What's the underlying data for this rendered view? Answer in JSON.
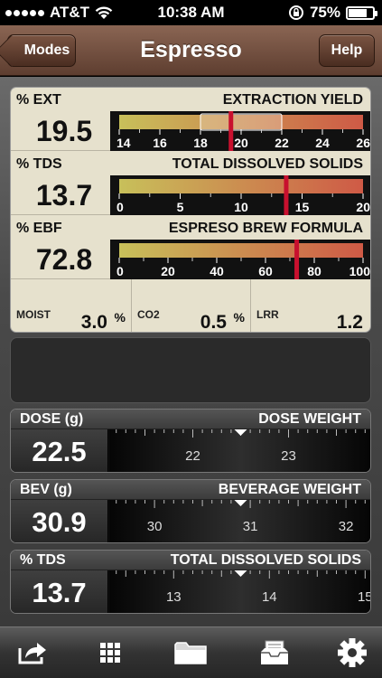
{
  "status_bar": {
    "carrier": "AT&T",
    "time": "10:38 AM",
    "battery": "75%",
    "battery_level": 0.75
  },
  "navbar": {
    "title": "Espresso",
    "left_button": "Modes",
    "right_button": "Help"
  },
  "results": [
    {
      "unit": "% EXT",
      "name": "EXTRACTION YIELD",
      "value": "19.5",
      "ticks": [
        "14",
        "16",
        "18",
        "20",
        "22",
        "24",
        "26"
      ],
      "min": 14,
      "max": 26,
      "marker": 19.5,
      "target_range": [
        18,
        22
      ]
    },
    {
      "unit": "% TDS",
      "name": "TOTAL DISSOLVED SOLIDS",
      "value": "13.7",
      "ticks": [
        "0",
        "5",
        "10",
        "15",
        "20"
      ],
      "min": 0,
      "max": 20,
      "marker": 13.7
    },
    {
      "unit": "% EBF",
      "name": "ESPRESO BREW FORMULA",
      "value": "72.8",
      "ticks": [
        "0",
        "20",
        "40",
        "60",
        "80",
        "100"
      ],
      "min": 0,
      "max": 100,
      "marker": 72.8
    }
  ],
  "secondary": [
    {
      "label": "MOIST",
      "value": "3.0",
      "unit": "%"
    },
    {
      "label": "CO2",
      "value": "0.5",
      "unit": "%"
    },
    {
      "label": "LRR",
      "value": "1.2",
      "unit": ""
    }
  ],
  "inputs": [
    {
      "unit": "DOSE (g)",
      "name": "DOSE WEIGHT",
      "value": "22.5",
      "ticks": [
        "22",
        "23"
      ]
    },
    {
      "unit": "BEV (g)",
      "name": "BEVERAGE WEIGHT",
      "value": "30.9",
      "ticks": [
        "30",
        "31",
        "32"
      ]
    },
    {
      "unit": "% TDS",
      "name": "TOTAL DISSOLVED SOLIDS",
      "value": "13.7",
      "ticks": [
        "13",
        "14",
        "15"
      ]
    }
  ],
  "toolbar": [
    {
      "icon": "share-icon"
    },
    {
      "icon": "grid-icon"
    },
    {
      "icon": "folder-icon"
    },
    {
      "icon": "inbox-icon"
    },
    {
      "icon": "gear-icon"
    }
  ],
  "colors": {
    "nav_brown": "#6e4c3c",
    "panel_cream": "#e6e1cd",
    "marker_red": "#c8102e",
    "gauge_yellow": "#c8c05a",
    "gauge_red": "#cf5a46"
  }
}
